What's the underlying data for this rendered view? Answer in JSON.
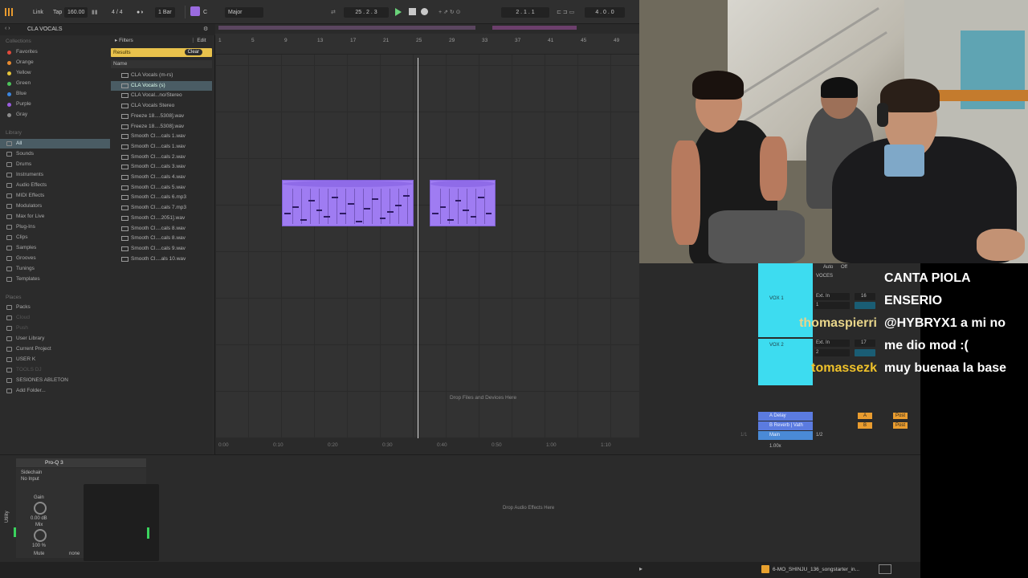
{
  "transport": {
    "link": "Link",
    "tap": "Tap",
    "tempo": "160.00",
    "time_sig": "4 / 4",
    "quantize": "1 Bar",
    "key": "C",
    "scale": "Major",
    "position": "25 . 2 . 3",
    "loop_start": "2 . 1 . 1",
    "loop_length": "4 . 0 . 0"
  },
  "browser": {
    "title": "CLA VOCALS",
    "collections_title": "Collections",
    "collections": [
      {
        "label": "Favorites",
        "color": "#e24a3b"
      },
      {
        "label": "Orange",
        "color": "#e98a2f"
      },
      {
        "label": "Yellow",
        "color": "#e6c53a"
      },
      {
        "label": "Green",
        "color": "#4cc35a"
      },
      {
        "label": "Blue",
        "color": "#3b86e0"
      },
      {
        "label": "Purple",
        "color": "#9b5de0"
      },
      {
        "label": "Gray",
        "color": "#8c8c8c"
      }
    ],
    "library_title": "Library",
    "library": [
      "All",
      "Sounds",
      "Drums",
      "Instruments",
      "Audio Effects",
      "MIDI Effects",
      "Modulators",
      "Max for Live",
      "Plug-Ins",
      "Clips",
      "Samples",
      "Grooves",
      "Tunings",
      "Templates"
    ],
    "places_title": "Places",
    "places": [
      "Packs",
      "Cloud",
      "Push",
      "User Library",
      "Current Project",
      "USER K",
      "TOOLS DJ",
      "SESIONES ABLETON",
      "Add Folder..."
    ],
    "filters": "Filters",
    "edit": "Edit",
    "results": "Results",
    "clear": "Clear",
    "column_name": "Name",
    "files": [
      "CLA Vocals (m-rs)",
      "CLA Vocals (s)",
      "CLA Vocal...no/Stereo",
      "CLA Vocals Stereo",
      "Freeze 18....5308].wav",
      "Freeze 18....5308].wav",
      "Smooth Cl....cals 1.wav",
      "Smooth Cl....cals 1.wav",
      "Smooth Cl....cals 2.wav",
      "Smooth Cl....cals 3.wav",
      "Smooth Cl....cals 4.wav",
      "Smooth Cl....cals 5.wav",
      "Smooth Cl....cals 6.mp3",
      "Smooth Cl....cals 7.mp3",
      "Smooth Cl....2051].wav",
      "Smooth Cl....cals 8.wav",
      "Smooth Cl....cals 8.wav",
      "Smooth Cl....cals 9.wav",
      "Smooth Cl....als 10.wav"
    ]
  },
  "arrangement": {
    "ruler": [
      "1",
      "5",
      "9",
      "13",
      "17",
      "21",
      "25",
      "29",
      "33",
      "37",
      "41",
      "45",
      "49"
    ],
    "time": [
      "0:00",
      "0:10",
      "0:20",
      "0:30",
      "0:40",
      "0:50",
      "1:00",
      "1:10",
      "1:20",
      "1:30"
    ],
    "drop_hint": "Drop Files and Devices Here",
    "page": "1/1"
  },
  "mixer": {
    "auto": "Auto",
    "off": "Off",
    "group_name": "VOCES",
    "tracks": [
      {
        "name": "VOX 1",
        "input": "Ext. In",
        "channel": "1",
        "number": "16"
      },
      {
        "name": "VOX 2",
        "input": "Ext. In",
        "channel": "2",
        "number": "17"
      }
    ],
    "track_color": "#3ddcf0",
    "returns": [
      {
        "name": "A Delay",
        "send": "A"
      },
      {
        "name": "B Reverb | Vath",
        "send": "B"
      }
    ],
    "main": "Main",
    "main_routing": "1/2",
    "post": "Post",
    "zoom": "1.00x"
  },
  "device": {
    "name": "Pro-Q 3",
    "sidechain": "Sidechain",
    "sidechain_input": "No Input",
    "gain": "Gain",
    "gain_value": "0.00 dB",
    "mix": "Mix",
    "mix_value": "100 %",
    "mute": "Mute",
    "none1": "none",
    "none2": "none",
    "drop_hint": "Drop Audio Effects Here",
    "side_label": "Utility"
  },
  "status": {
    "song": "6-MO_SHINJU_136_songstarter_in..."
  },
  "chat": {
    "messages": [
      {
        "user": "",
        "text": "CANTA PIOLA"
      },
      {
        "user": "",
        "text": "ENSERIO"
      },
      {
        "user": "thomaspierri",
        "user_color": "#e8d58a",
        "text": "@HYBRYX1 a mi no"
      },
      {
        "user": "",
        "text": "me dio mod :("
      },
      {
        "user": "tomassezk",
        "user_color": "#f0c22a",
        "text": "muy buenaa la base"
      }
    ]
  }
}
